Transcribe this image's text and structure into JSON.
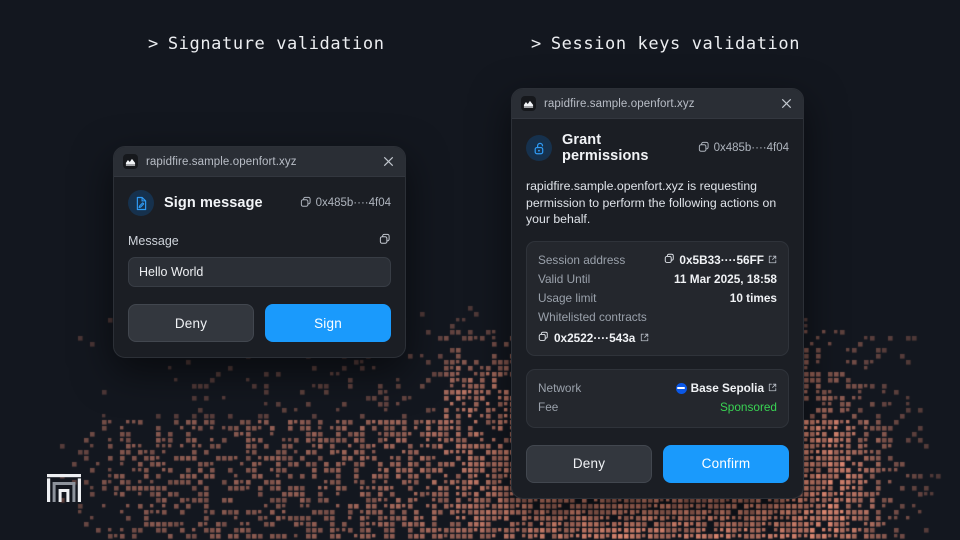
{
  "page": {
    "background_color": "#13171f",
    "accent_color": "#1a9afc",
    "particle_color": "#f0937a"
  },
  "headings": {
    "left": {
      "caret": ">",
      "text": "Signature validation"
    },
    "right": {
      "caret": ">",
      "text": "Session keys validation"
    }
  },
  "sign_card": {
    "titlebar": {
      "favicon_name": "site-favicon",
      "url": "rapidfire.sample.openfort.xyz",
      "close_label": "✕"
    },
    "header": {
      "icon_name": "sign-document-icon",
      "title": "Sign message",
      "address": "0x485b····4f04",
      "copy_icon": "copy-icon"
    },
    "message_label": "Message",
    "message_copy_icon": "copy-icon",
    "message_value": "Hello World",
    "buttons": {
      "deny": "Deny",
      "primary": "Sign"
    }
  },
  "permissions_card": {
    "titlebar": {
      "favicon_name": "site-favicon",
      "url": "rapidfire.sample.openfort.xyz",
      "close_label": "✕"
    },
    "header": {
      "icon_name": "unlocked-padlock-icon",
      "title": "Grant permissions",
      "address": "0x485b····4f04",
      "copy_icon": "copy-icon"
    },
    "description": "rapidfire.sample.openfort.xyz is requesting permission to perform the following actions on your behalf.",
    "details": [
      {
        "key": "Session address",
        "value": "0x5B33····56FF",
        "has_copy": true,
        "has_external": true
      },
      {
        "key": "Valid Until",
        "value": "11 Mar 2025, 18:58",
        "has_copy": false,
        "has_external": false
      },
      {
        "key": "Usage limit",
        "value": "10 times",
        "has_copy": false,
        "has_external": false
      }
    ],
    "whitelisted_label": "Whitelisted contracts",
    "whitelisted_contract": "0x2522····543a",
    "network": {
      "key": "Network",
      "value": "Base Sepolia",
      "chain_color": "#0a57e6"
    },
    "fee": {
      "key": "Fee",
      "value": "Sponsored",
      "color": "#39d353"
    },
    "buttons": {
      "deny": "Deny",
      "primary": "Confirm"
    }
  },
  "logo": {
    "name": "openfort-logo"
  }
}
